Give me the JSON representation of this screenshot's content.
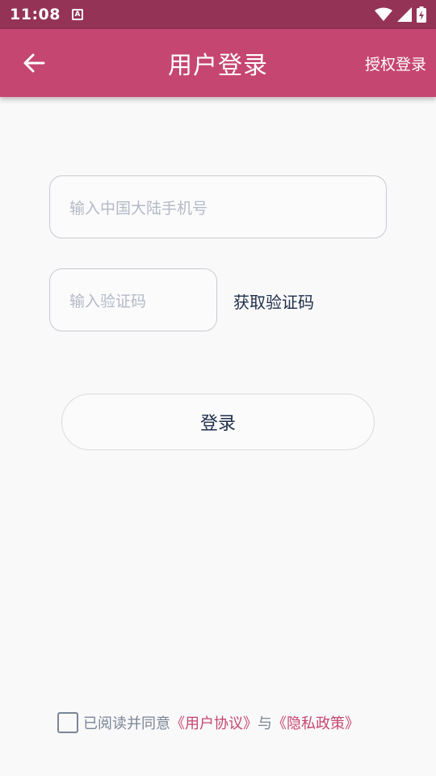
{
  "status_bar": {
    "time": "11:08",
    "notification_icon": "a-box-icon",
    "wifi_icon": "wifi-icon",
    "signal_icon": "signal-icon",
    "battery_icon": "battery-charging-icon"
  },
  "app_bar": {
    "back_icon": "arrow-left-icon",
    "title": "用户登录",
    "action_label": "授权登录",
    "color": "#c64672"
  },
  "form": {
    "phone_placeholder": "输入中国大陆手机号",
    "code_placeholder": "输入验证码",
    "get_code_label": "获取验证码",
    "login_label": "登录"
  },
  "agreement": {
    "prefix": "已阅读并同意",
    "user_agreement": "《用户协议》",
    "conjunction": "与",
    "privacy_policy": "《隐私政策》",
    "checked": false
  }
}
